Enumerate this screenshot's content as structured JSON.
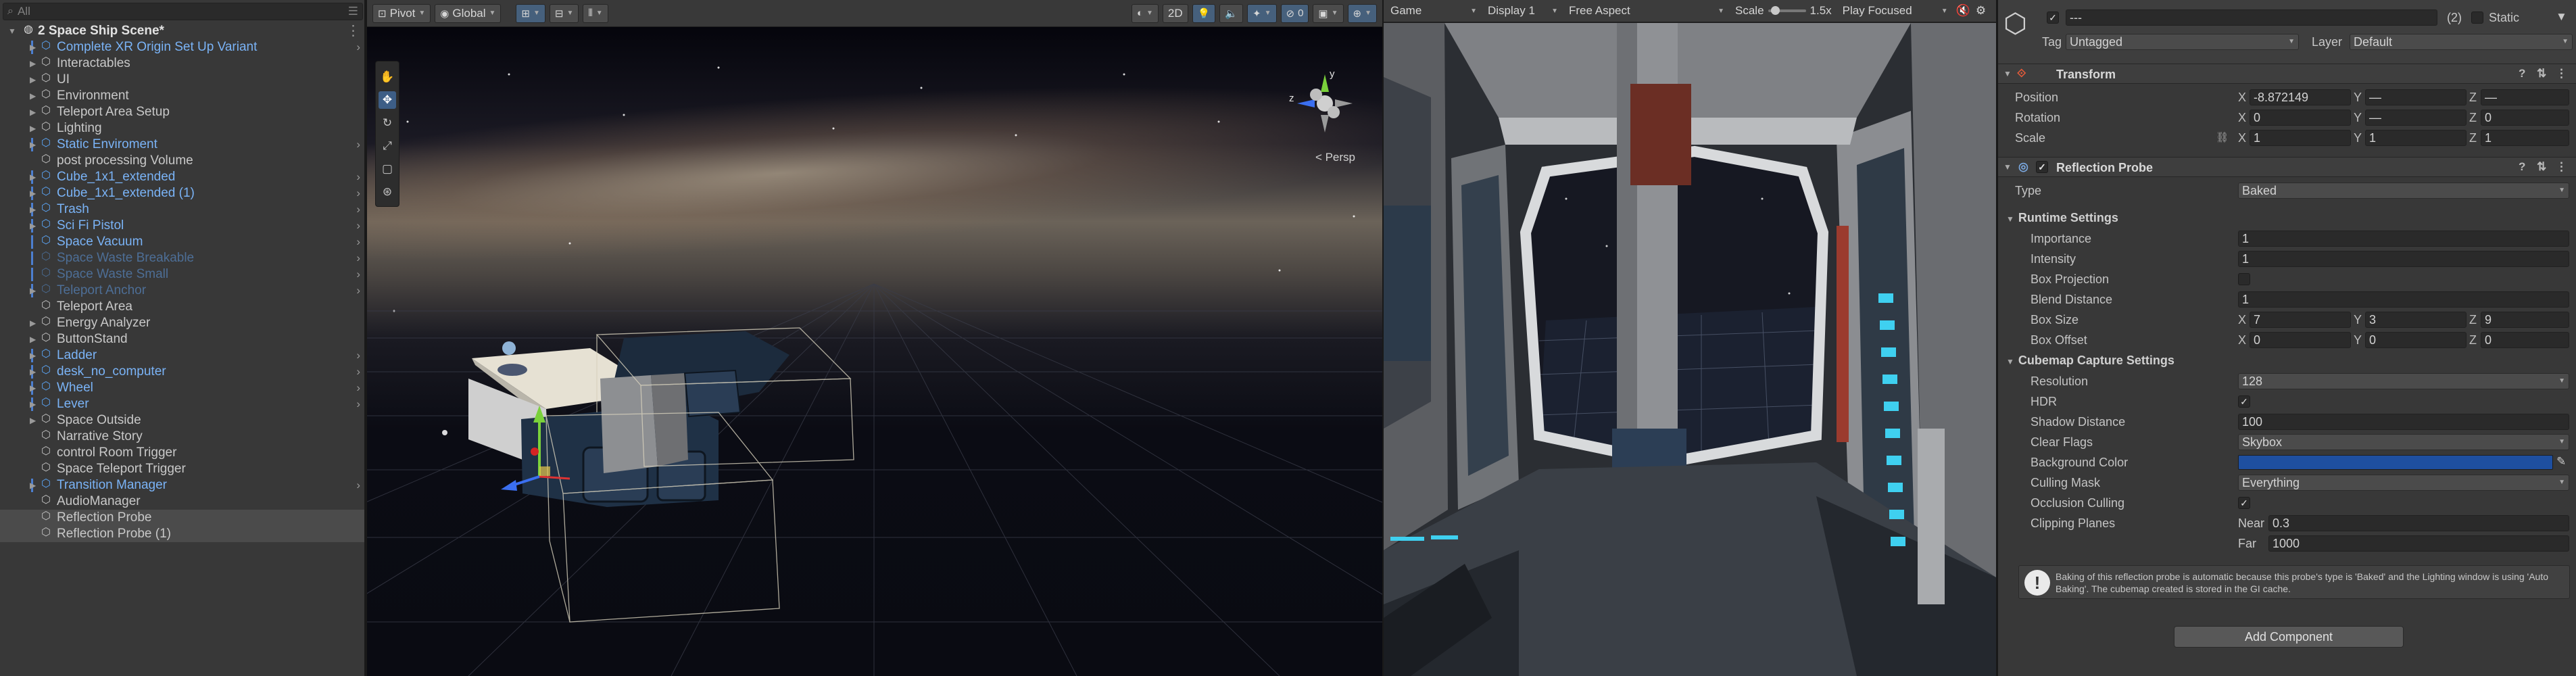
{
  "hierarchy": {
    "search_placeholder": "All",
    "scene_name": "2 Space Ship Scene*",
    "items": [
      {
        "label": "Complete XR Origin Set Up Variant",
        "style": "prefab",
        "expand": true,
        "more": true
      },
      {
        "label": "Interactables",
        "style": "plain",
        "expand": true,
        "more": false
      },
      {
        "label": "UI",
        "style": "plain",
        "expand": true,
        "more": false
      },
      {
        "label": "Environment",
        "style": "plain",
        "expand": true,
        "more": false
      },
      {
        "label": "Teleport Area Setup",
        "style": "plain",
        "expand": true,
        "more": false
      },
      {
        "label": "Lighting",
        "style": "plain",
        "expand": true,
        "more": false
      },
      {
        "label": "Static Enviroment",
        "style": "prefab",
        "expand": true,
        "more": true
      },
      {
        "label": "post processing Volume",
        "style": "plain",
        "expand": false,
        "more": false
      },
      {
        "label": "Cube_1x1_extended",
        "style": "prefab",
        "expand": true,
        "more": true
      },
      {
        "label": "Cube_1x1_extended (1)",
        "style": "prefab",
        "expand": true,
        "more": true
      },
      {
        "label": "Trash",
        "style": "prefab",
        "expand": true,
        "more": true
      },
      {
        "label": "Sci Fi Pistol",
        "style": "prefab",
        "expand": true,
        "more": true
      },
      {
        "label": "Space Vacuum",
        "style": "prefab",
        "expand": false,
        "more": true
      },
      {
        "label": "Space Waste Breakable",
        "style": "faded",
        "expand": false,
        "more": true
      },
      {
        "label": "Space Waste Small",
        "style": "faded",
        "expand": false,
        "more": true
      },
      {
        "label": "Teleport Anchor",
        "style": "faded",
        "expand": true,
        "more": true
      },
      {
        "label": "Teleport Area",
        "style": "plain",
        "expand": false,
        "more": false
      },
      {
        "label": "Energy Analyzer",
        "style": "plain",
        "expand": true,
        "more": false
      },
      {
        "label": "ButtonStand",
        "style": "plain",
        "expand": true,
        "more": false
      },
      {
        "label": "Ladder",
        "style": "prefab",
        "expand": true,
        "more": true
      },
      {
        "label": "desk_no_computer",
        "style": "prefab",
        "expand": true,
        "more": true
      },
      {
        "label": "Wheel",
        "style": "prefab",
        "expand": true,
        "more": true
      },
      {
        "label": "Lever",
        "style": "prefab",
        "expand": true,
        "more": true
      },
      {
        "label": "Space Outside",
        "style": "plain",
        "expand": true,
        "more": false
      },
      {
        "label": "Narrative Story",
        "style": "plain",
        "expand": false,
        "more": false
      },
      {
        "label": "control Room Trigger",
        "style": "plain",
        "expand": false,
        "more": false
      },
      {
        "label": "Space Teleport Trigger",
        "style": "plain",
        "expand": false,
        "more": false
      },
      {
        "label": "Transition Manager",
        "style": "prefab",
        "expand": true,
        "more": true
      },
      {
        "label": "AudioManager",
        "style": "plain",
        "expand": false,
        "more": false
      },
      {
        "label": "Reflection Probe",
        "style": "selected",
        "expand": false,
        "more": false
      },
      {
        "label": "Reflection Probe (1)",
        "style": "selected",
        "expand": false,
        "more": false
      }
    ]
  },
  "scene_toolbar": {
    "pivot_label": "Pivot",
    "global_label": "Global",
    "twod_label": "2D",
    "persp_label": "< Persp",
    "gizmo_axes": {
      "y": "y",
      "z": "z"
    }
  },
  "game_toolbar": {
    "tab_label": "Game",
    "display_label": "Display 1",
    "aspect_label": "Free Aspect",
    "scale_label": "Scale",
    "scale_value": "1.5x",
    "scale_fraction": 0.1,
    "play_focused_label": "Play Focused"
  },
  "inspector": {
    "object_name": "---",
    "object_count": "(2)",
    "static_label": "Static",
    "tag_label": "Tag",
    "tag_value": "Untagged",
    "layer_label": "Layer",
    "layer_value": "Default",
    "transform": {
      "title": "Transform",
      "position_label": "Position",
      "rotation_label": "Rotation",
      "scale_label": "Scale",
      "position": {
        "x": "-8.872149",
        "y": "—",
        "z": "—"
      },
      "rotation": {
        "x": "0",
        "y": "—",
        "z": "0"
      },
      "scale": {
        "x": "1",
        "y": "1",
        "z": "1"
      }
    },
    "axis_labels": {
      "x": "X",
      "y": "Y",
      "z": "Z"
    },
    "probe": {
      "title": "Reflection Probe",
      "type_label": "Type",
      "type_value": "Baked",
      "runtime_title": "Runtime Settings",
      "importance_label": "Importance",
      "importance_value": "1",
      "intensity_label": "Intensity",
      "intensity_value": "1",
      "box_projection_label": "Box Projection",
      "blend_distance_label": "Blend Distance",
      "blend_distance_value": "1",
      "box_size_label": "Box Size",
      "box_size": {
        "x": "7",
        "y": "3",
        "z": "9"
      },
      "box_offset_label": "Box Offset",
      "box_offset": {
        "x": "0",
        "y": "0",
        "z": "0"
      },
      "cubemap_title": "Cubemap Capture Settings",
      "resolution_label": "Resolution",
      "resolution_value": "128",
      "hdr_label": "HDR",
      "shadow_distance_label": "Shadow Distance",
      "shadow_distance_value": "100",
      "clear_flags_label": "Clear Flags",
      "clear_flags_value": "Skybox",
      "background_color_label": "Background Color",
      "background_color": "#1e4fa0",
      "culling_mask_label": "Culling Mask",
      "culling_mask_value": "Everything",
      "occlusion_culling_label": "Occlusion Culling",
      "clipping_planes_label": "Clipping Planes",
      "near_label": "Near",
      "near_value": "0.3",
      "far_label": "Far",
      "far_value": "1000",
      "help_text": "Baking of this reflection probe is automatic because this probe's type is 'Baked' and the Lighting window is using 'Auto Baking'. The cubemap created is stored in the GI cache."
    },
    "add_component_label": "Add Component"
  },
  "colors": {
    "accent": "#4c7fd0",
    "prefab_text": "#7ab3f6",
    "panel_bg": "#383838"
  }
}
